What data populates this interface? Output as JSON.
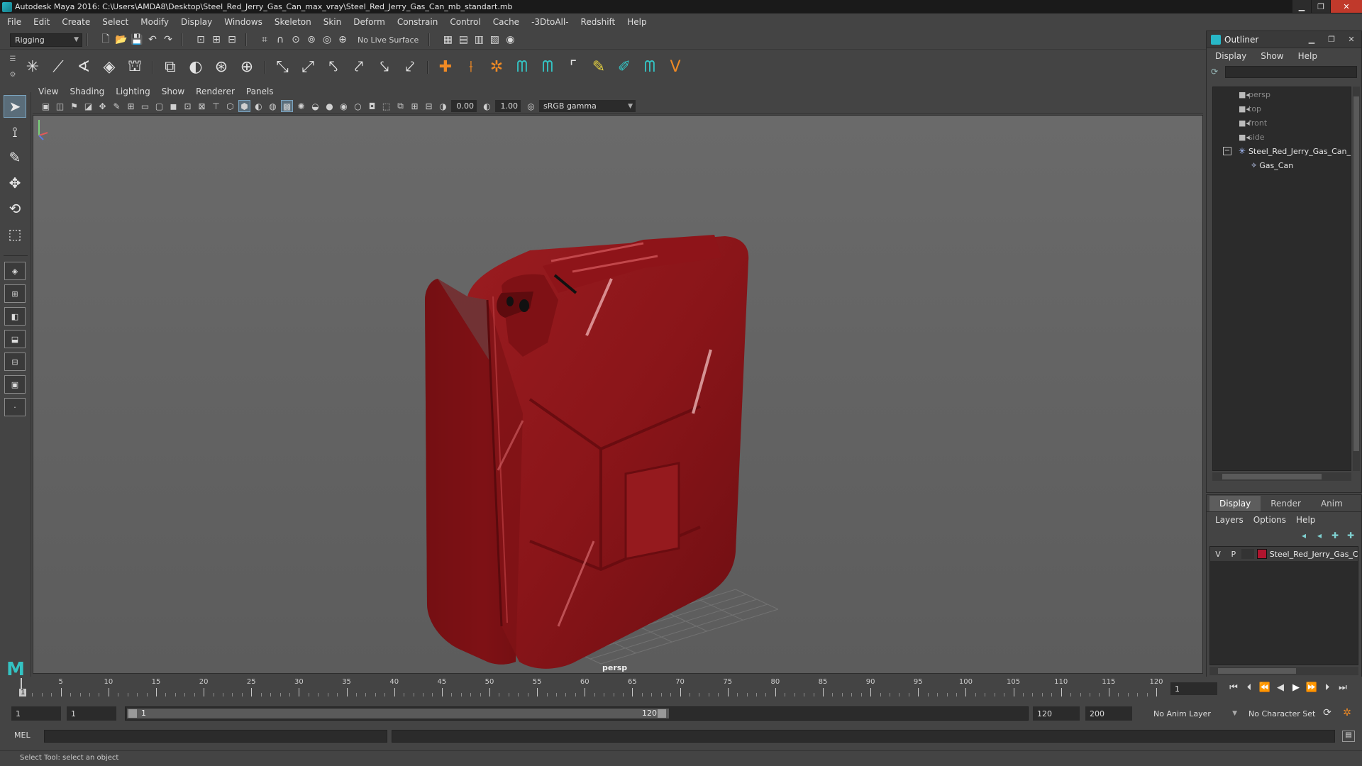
{
  "window": {
    "title": "Autodesk Maya 2016: C:\\Users\\AMDA8\\Desktop\\Steel_Red_Jerry_Gas_Can_max_vray\\Steel_Red_Jerry_Gas_Can_mb_standart.mb",
    "minimize": "▁",
    "maximize": "❐",
    "close": "✕"
  },
  "menubar": [
    "File",
    "Edit",
    "Create",
    "Select",
    "Modify",
    "Display",
    "Windows",
    "Skeleton",
    "Skin",
    "Deform",
    "Constrain",
    "Control",
    "Cache",
    "-3DtoAll-",
    "Redshift",
    "Help"
  ],
  "statusline": {
    "menu_set": "Rigging",
    "live_surface": "No Live Surface"
  },
  "viewport": {
    "menus": [
      "View",
      "Shading",
      "Lighting",
      "Show",
      "Renderer",
      "Panels"
    ],
    "exposure": "0.00",
    "gamma_value": "1.00",
    "color_space": "sRGB gamma",
    "camera_label": "persp",
    "model_color": "#8b1419"
  },
  "outliner": {
    "title": "Outliner",
    "menus": [
      "Display",
      "Show",
      "Help"
    ],
    "items": [
      {
        "label": "persp"
      },
      {
        "label": "top"
      },
      {
        "label": "front"
      },
      {
        "label": "side"
      },
      {
        "label": "Steel_Red_Jerry_Gas_Can_"
      },
      {
        "label": "Gas_Can"
      }
    ],
    "expand_glyph": "−"
  },
  "layers": {
    "tabs": [
      "Display",
      "Render",
      "Anim"
    ],
    "menus": [
      "Layers",
      "Options",
      "Help"
    ],
    "rows": [
      {
        "v": "V",
        "p": "P",
        "name": "Steel_Red_Jerry_Gas_C",
        "color": "#b0142e"
      }
    ]
  },
  "timeline": {
    "ticks": [
      1,
      5,
      10,
      15,
      20,
      25,
      30,
      35,
      40,
      45,
      50,
      55,
      60,
      65,
      70,
      75,
      80,
      85,
      90,
      95,
      100,
      105,
      110,
      115,
      120
    ],
    "current_frame": "1",
    "frame_field": "1"
  },
  "range": {
    "start": "1",
    "playback_start": "1",
    "slider_start": "1",
    "slider_end": "120",
    "playback_end": "120",
    "end": "200",
    "anim_layer": "No Anim Layer",
    "character_set": "No Character Set"
  },
  "cmdline": {
    "label": "MEL"
  },
  "helpline": {
    "text": "Select Tool: select an object"
  }
}
